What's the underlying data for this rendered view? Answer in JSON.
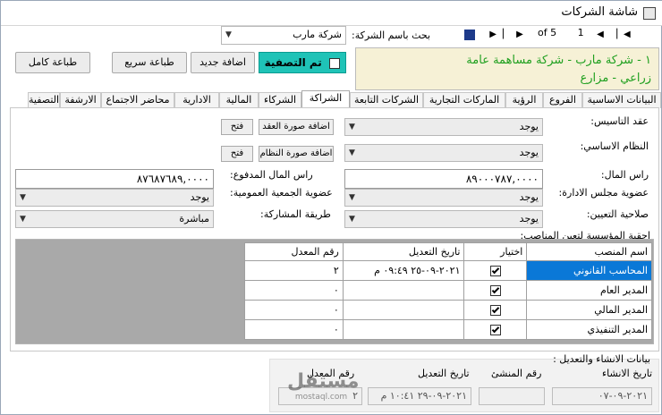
{
  "window": {
    "title": "شاشة الشركات"
  },
  "nav": {
    "page_of": "of 5",
    "current_page": "1"
  },
  "search": {
    "label": "بحث باسم الشركة:",
    "value": "شركة مارب"
  },
  "info_box": {
    "line1": "١ - شركة مارب - شركة مساهمة عامة",
    "line2": "زراعي - مزارع"
  },
  "filter": {
    "label": "تم التصفية",
    "checked": false
  },
  "toolbar": {
    "add_new": "اضافة جديد",
    "quick_print": "طباعة سريع",
    "full_print": "طباعة كامل"
  },
  "tabs": [
    {
      "label": "البيانات الاساسية"
    },
    {
      "label": "الفروع"
    },
    {
      "label": "الرؤية"
    },
    {
      "label": "الماركات التجارية"
    },
    {
      "label": "الشركات التابعة"
    },
    {
      "label": "الشراكة"
    },
    {
      "label": "الشركاء"
    },
    {
      "label": "المالية"
    },
    {
      "label": "الادارية"
    },
    {
      "label": "محاضر الاجتماع"
    },
    {
      "label": "الارشفة"
    },
    {
      "label": "التصفية"
    }
  ],
  "active_tab": "الشراكة",
  "form": {
    "incorporation_contract": {
      "label": "عقد التاسيس:",
      "value": "يوجد",
      "add_image": "اضافة صورة العقد",
      "open": "فتح"
    },
    "bylaws": {
      "label": "النظام الاساسي:",
      "value": "يوجد",
      "add_image": "اضافة صورة النظام",
      "open": "فتح"
    },
    "capital": {
      "label": "راس المال:",
      "value": "٨٩٠٠٠٧٨٧,٠٠٠٠"
    },
    "paid_capital": {
      "label": "راس المال المدفوع:",
      "value": "٨٧٦٨٧٦٨٩,٠٠٠٠"
    },
    "board_membership": {
      "label": "عضوية مجلس الادارة:",
      "value": "يوجد"
    },
    "assembly_membership": {
      "label": "عضوية الجمعية العمومية:",
      "value": "يوجد"
    },
    "appointment_authority": {
      "label": "صلاحية التعيين:",
      "value": "يوجد"
    },
    "participation_method": {
      "label": "طريقة المشاركة:",
      "value": "مباشرة"
    }
  },
  "positions": {
    "title": "احقية المؤسسة لتعين المناصب:",
    "headers": {
      "position_name": "اسم المنصب",
      "selected": "اختيار",
      "modified_date": "تاريخ التعديل",
      "modifier_no": "رقم المعدل"
    },
    "rows": [
      {
        "position_name": "المحاسب القانوني",
        "selected": true,
        "modified_date": "٢٠٢١-٠٩-٢٥ ٠٩:٤٩ م",
        "modifier_no": "٢"
      },
      {
        "position_name": "المدير العام",
        "selected": true,
        "modified_date": "",
        "modifier_no": "٠"
      },
      {
        "position_name": "المدير المالي",
        "selected": true,
        "modified_date": "",
        "modifier_no": "٠"
      },
      {
        "position_name": "المدير التنفيذي",
        "selected": true,
        "modified_date": "",
        "modifier_no": "٠"
      }
    ]
  },
  "footer": {
    "title": "بيانات الانشاء والتعديل :",
    "creation_date_label": "تاريخ الانشاء",
    "creator_no_label": "رقم المنشئ",
    "modified_date_label": "تاريخ التعديل",
    "modifier_no_label": "رقم المعدل",
    "creation_date_value": "٢٠٢١-٠٩-٠٧",
    "creator_no_value": "",
    "modified_date_value": "٢٠٢١-٠٩-٢٩ ١٠:٤١ م",
    "modifier_no_value": "٢"
  },
  "watermark": {
    "text": "مستقل",
    "latin": "mostaql.com"
  },
  "colors": {
    "info_bg": "#f6f1d6",
    "info_text": "#20a020",
    "filter_bg": "#1fc3b7",
    "selection": "#0a78d7"
  }
}
